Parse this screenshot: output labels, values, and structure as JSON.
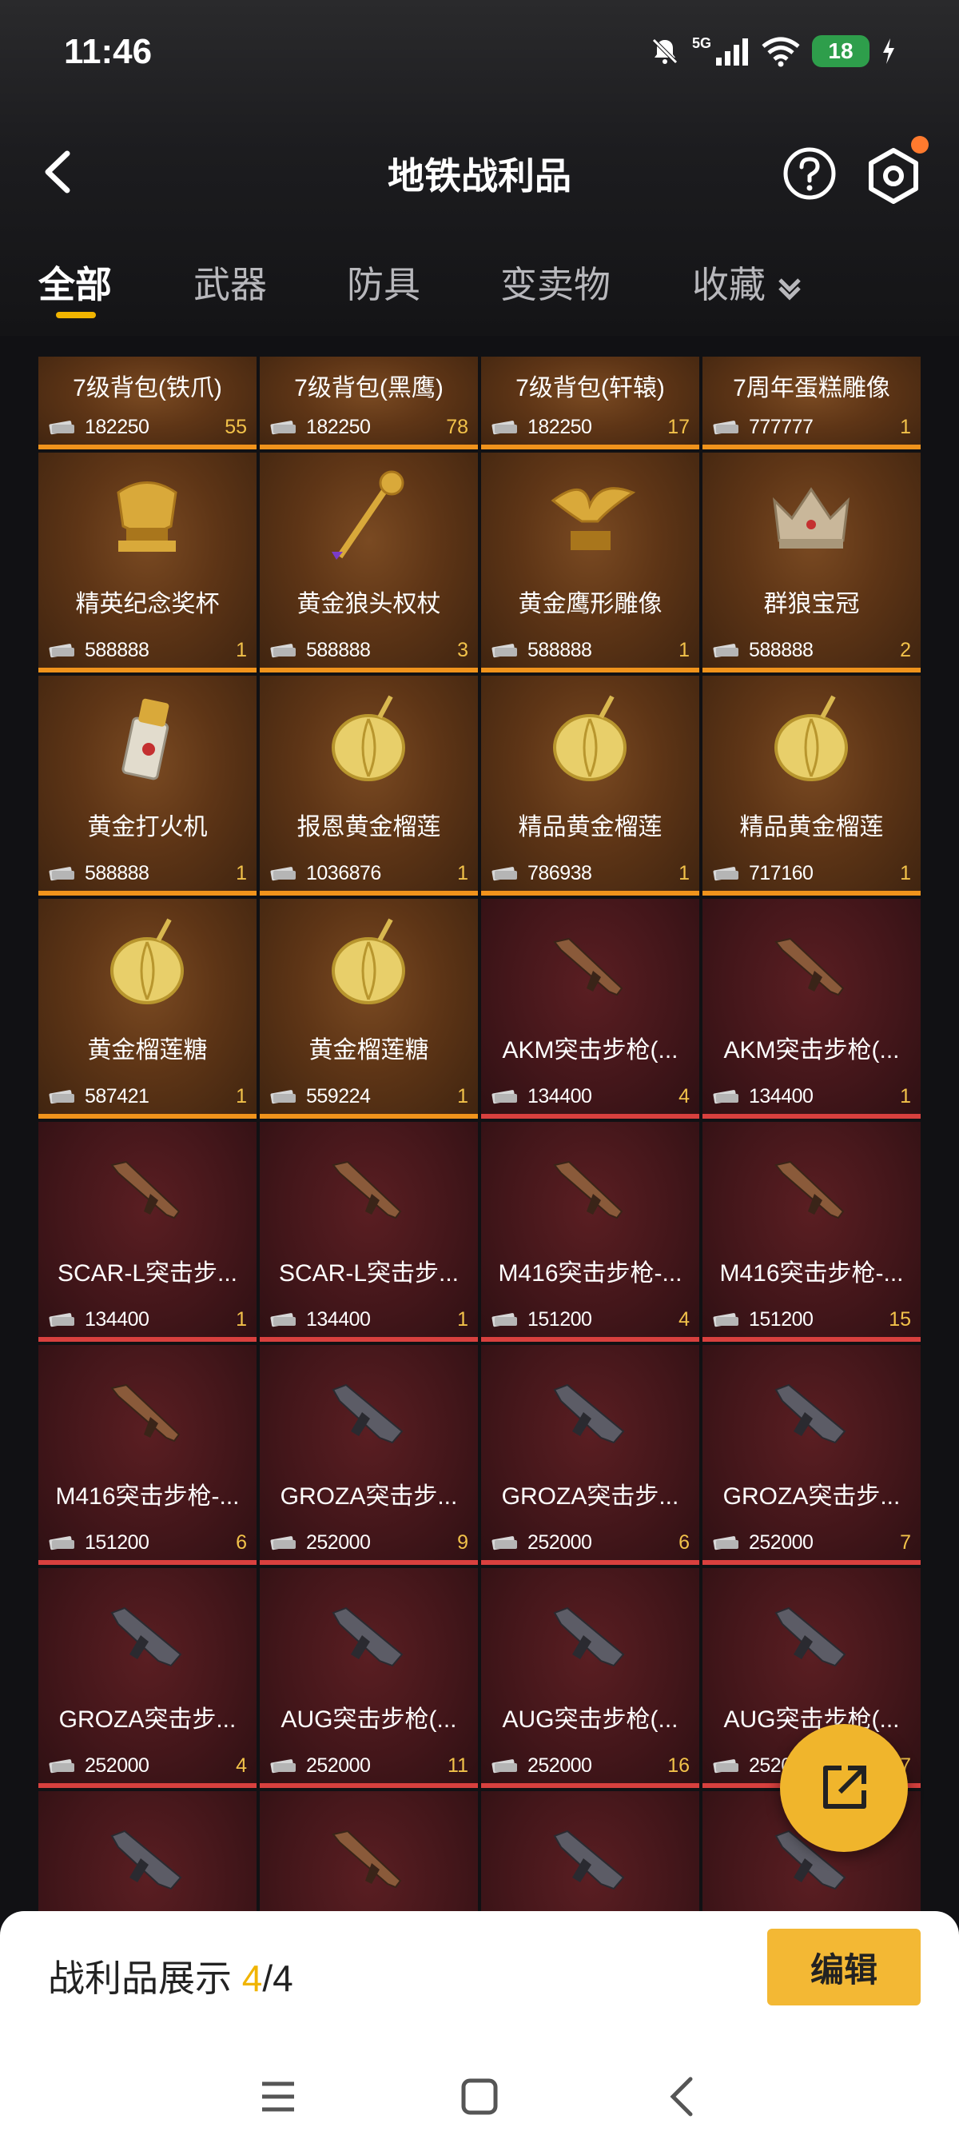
{
  "status_bar": {
    "time": "11:46",
    "network": "5G",
    "battery": "18"
  },
  "header": {
    "title": "地铁战利品"
  },
  "tabs": [
    {
      "label": "全部",
      "active": true
    },
    {
      "label": "武器",
      "active": false
    },
    {
      "label": "防具",
      "active": false
    },
    {
      "label": "变卖物",
      "active": false
    },
    {
      "label": "收藏",
      "active": false
    }
  ],
  "items": [
    {
      "name": "7级背包(铁爪)",
      "price": "182250",
      "count": "55",
      "rarity": "gold",
      "icon": "backpack-icon"
    },
    {
      "name": "7级背包(黑鹰)",
      "price": "182250",
      "count": "78",
      "rarity": "gold",
      "icon": "backpack-icon"
    },
    {
      "name": "7级背包(轩辕)",
      "price": "182250",
      "count": "17",
      "rarity": "gold",
      "icon": "backpack-icon"
    },
    {
      "name": "7周年蛋糕雕像",
      "price": "777777",
      "count": "1",
      "rarity": "gold",
      "icon": "cake-statue-icon"
    },
    {
      "name": "精英纪念奖杯",
      "price": "588888",
      "count": "1",
      "rarity": "gold",
      "icon": "trophy-icon"
    },
    {
      "name": "黄金狼头权杖",
      "price": "588888",
      "count": "3",
      "rarity": "gold",
      "icon": "scepter-icon"
    },
    {
      "name": "黄金鹰形雕像",
      "price": "588888",
      "count": "1",
      "rarity": "gold",
      "icon": "eagle-statue-icon"
    },
    {
      "name": "群狼宝冠",
      "price": "588888",
      "count": "2",
      "rarity": "gold",
      "icon": "crown-icon"
    },
    {
      "name": "黄金打火机",
      "price": "588888",
      "count": "1",
      "rarity": "gold",
      "icon": "lighter-icon"
    },
    {
      "name": "报恩黄金榴莲",
      "price": "1036876",
      "count": "1",
      "rarity": "gold",
      "icon": "durian-icon"
    },
    {
      "name": "精品黄金榴莲",
      "price": "786938",
      "count": "1",
      "rarity": "gold",
      "icon": "durian-icon"
    },
    {
      "name": "精品黄金榴莲",
      "price": "717160",
      "count": "1",
      "rarity": "gold",
      "icon": "durian-icon"
    },
    {
      "name": "黄金榴莲糖",
      "price": "587421",
      "count": "1",
      "rarity": "gold",
      "icon": "durian-icon"
    },
    {
      "name": "黄金榴莲糖",
      "price": "559224",
      "count": "1",
      "rarity": "gold",
      "icon": "durian-icon"
    },
    {
      "name": "AKM突击步枪(...",
      "price": "134400",
      "count": "4",
      "rarity": "red",
      "icon": "rifle-icon"
    },
    {
      "name": "AKM突击步枪(...",
      "price": "134400",
      "count": "1",
      "rarity": "red",
      "icon": "rifle-icon"
    },
    {
      "name": "SCAR-L突击步...",
      "price": "134400",
      "count": "1",
      "rarity": "red",
      "icon": "rifle-icon"
    },
    {
      "name": "SCAR-L突击步...",
      "price": "134400",
      "count": "1",
      "rarity": "red",
      "icon": "rifle-icon"
    },
    {
      "name": "M416突击步枪-...",
      "price": "151200",
      "count": "4",
      "rarity": "red",
      "icon": "rifle-icon"
    },
    {
      "name": "M416突击步枪-...",
      "price": "151200",
      "count": "15",
      "rarity": "red",
      "icon": "rifle-icon"
    },
    {
      "name": "M416突击步枪-...",
      "price": "151200",
      "count": "6",
      "rarity": "red",
      "icon": "rifle-icon"
    },
    {
      "name": "GROZA突击步...",
      "price": "252000",
      "count": "9",
      "rarity": "red",
      "icon": "bullpup-rifle-icon"
    },
    {
      "name": "GROZA突击步...",
      "price": "252000",
      "count": "6",
      "rarity": "red",
      "icon": "bullpup-rifle-icon"
    },
    {
      "name": "GROZA突击步...",
      "price": "252000",
      "count": "7",
      "rarity": "red",
      "icon": "bullpup-rifle-icon"
    },
    {
      "name": "GROZA突击步...",
      "price": "252000",
      "count": "4",
      "rarity": "red",
      "icon": "bullpup-rifle-icon"
    },
    {
      "name": "AUG突击步枪(...",
      "price": "252000",
      "count": "11",
      "rarity": "red",
      "icon": "bullpup-rifle-icon"
    },
    {
      "name": "AUG突击步枪(...",
      "price": "252000",
      "count": "16",
      "rarity": "red",
      "icon": "bullpup-rifle-icon"
    },
    {
      "name": "AUG突击步枪(...",
      "price": "252000",
      "count": "7",
      "rarity": "red",
      "icon": "bullpup-rifle-icon"
    },
    {
      "name": "",
      "price": "",
      "count": "",
      "rarity": "red",
      "icon": "bullpup-rifle-icon"
    },
    {
      "name": "",
      "price": "",
      "count": "",
      "rarity": "red",
      "icon": "rifle-icon"
    },
    {
      "name": "",
      "price": "",
      "count": "",
      "rarity": "red",
      "icon": "bullpup-rifle-icon"
    },
    {
      "name": "",
      "price": "",
      "count": "",
      "rarity": "red",
      "icon": "bullpup-rifle-icon"
    }
  ],
  "showcase": {
    "label": "战利品展示",
    "current": "4",
    "total": "/4"
  },
  "edit_button": "编辑",
  "colors": {
    "accent": "#f0b400",
    "gold_card": "#5e3516",
    "red_card": "#43161a",
    "gold_bar": "#f0931c",
    "red_bar": "#d8403e"
  }
}
